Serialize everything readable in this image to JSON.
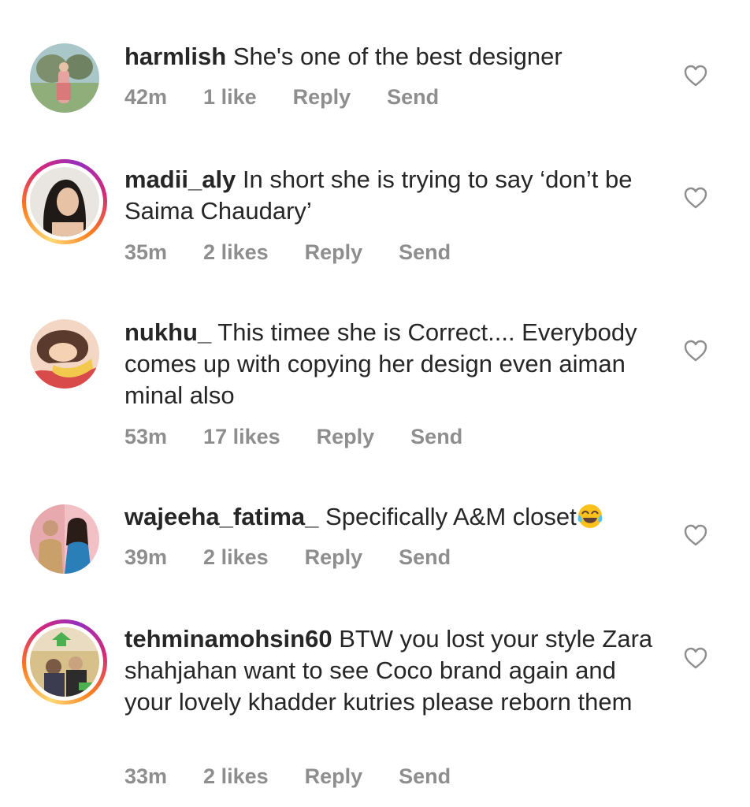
{
  "comments": [
    {
      "username": "harmlish",
      "text": "She's one of the best designer",
      "time": "42m",
      "likes": "1 like",
      "reply": "Reply",
      "send": "Send",
      "has_story": false
    },
    {
      "username": "madii_aly",
      "text": "In short she is trying to say ‘don’t be Saima Chaudary’",
      "time": "35m",
      "likes": "2 likes",
      "reply": "Reply",
      "send": "Send",
      "has_story": true
    },
    {
      "username": "nukhu_",
      "text": "This timee she is Correct.... Everybody comes up with copying her design even aiman minal also",
      "time": "53m",
      "likes": "17 likes",
      "reply": "Reply",
      "send": "Send",
      "has_story": false
    },
    {
      "username": "wajeeha_fatima_",
      "text": "Specifically A&M closet",
      "emoji": "face-with-tears-of-joy",
      "time": "39m",
      "likes": "2 likes",
      "reply": "Reply",
      "send": "Send",
      "has_story": false
    },
    {
      "username": "tehminamohsin60",
      "text": "BTW you lost your style Zara shahjahan want to see Coco brand again and your lovely khadder kutries please reborn them",
      "time": "33m",
      "likes": "2 likes",
      "reply": "Reply",
      "send": "Send",
      "has_story": true
    }
  ],
  "icons": {
    "like": "heart-outline-icon"
  },
  "colors": {
    "text": "#262626",
    "meta": "#8e8e8e",
    "heart": "#8e8e8e"
  }
}
